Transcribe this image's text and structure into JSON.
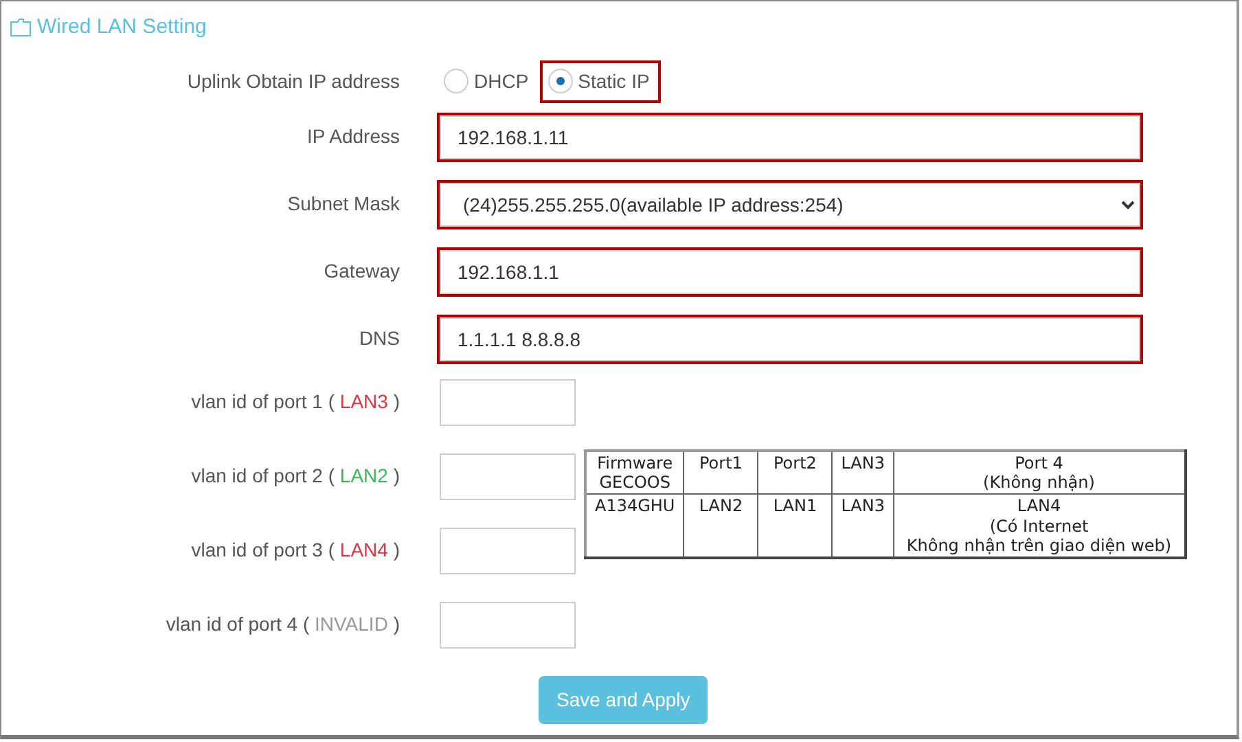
{
  "section": {
    "title": "Wired LAN Setting"
  },
  "uplink": {
    "label": "Uplink Obtain IP address",
    "options": [
      {
        "label": "DHCP",
        "selected": false,
        "highlighted": false
      },
      {
        "label": "Static IP",
        "selected": true,
        "highlighted": true
      }
    ]
  },
  "fields": [
    {
      "label": "IP Address",
      "kind": "text",
      "value": "192.168.1.11",
      "highlighted": true
    },
    {
      "label": "Subnet Mask",
      "kind": "select",
      "value": "(24)255.255.255.0(available IP address:254)",
      "highlighted": true
    },
    {
      "label": "Gateway",
      "kind": "text",
      "value": "192.168.1.1",
      "highlighted": true
    },
    {
      "label": "DNS",
      "kind": "text",
      "value": "1.1.1.1 8.8.8.8",
      "highlighted": true
    }
  ],
  "vlans": [
    {
      "prefix": "vlan id of port 1 (",
      "tag": "LAN3",
      "color": "#dc3545",
      "suffix": ")"
    },
    {
      "prefix": "vlan id of port 2 (",
      "tag": "LAN2",
      "color": "#3cb85c",
      "suffix": ")"
    },
    {
      "prefix": "vlan id of port 3 (",
      "tag": "LAN4",
      "color": "#dc3545",
      "suffix": ")"
    },
    {
      "prefix": "vlan id of port 4 (",
      "tag": "INVALID",
      "color": "#999999",
      "suffix": ")"
    }
  ],
  "port_table": {
    "columns": [
      "Firmware\nGECOOS",
      "Port1",
      "Port2",
      "LAN3",
      "Port 4\n(Không nhận)"
    ],
    "rows": [
      [
        "A134GHU",
        "LAN2",
        "LAN1",
        "LAN3",
        "LAN4\n(Có Internet\nKhông nhận trên giao diện web)"
      ]
    ]
  },
  "save_button": "Save and Apply"
}
